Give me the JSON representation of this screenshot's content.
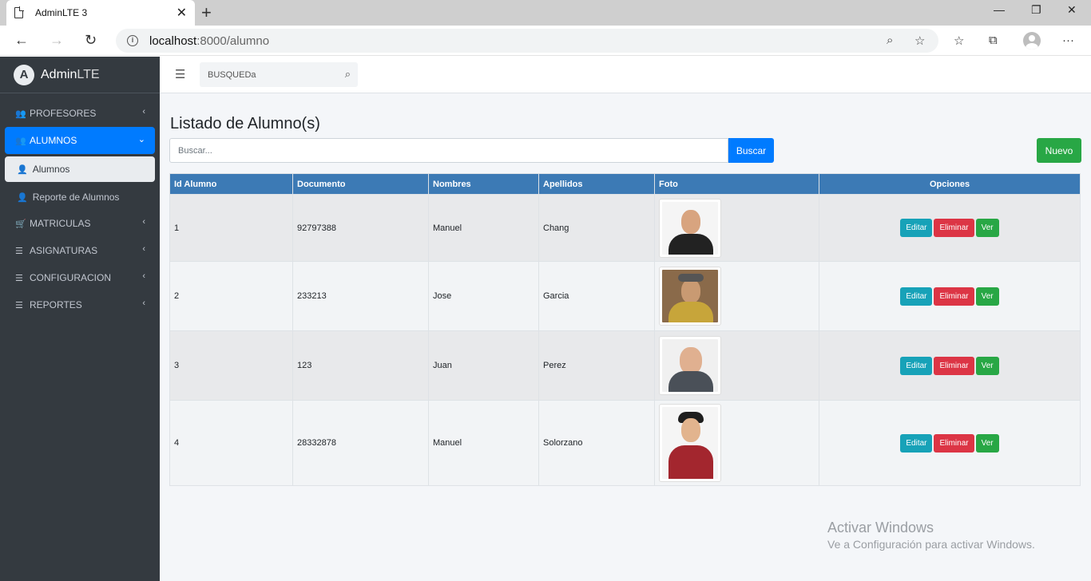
{
  "browser": {
    "tab_title": "AdminLTE 3",
    "url_host": "localhost",
    "url_path": ":8000/alumno"
  },
  "sidebar": {
    "brand_bold": "Admin",
    "brand_light": "LTE",
    "items": [
      {
        "label": "PROFESORES",
        "icon": "users-icon"
      },
      {
        "label": "ALUMNOS",
        "icon": "users-icon",
        "active": true
      },
      {
        "label": "MATRICULAS",
        "icon": "cart-icon"
      },
      {
        "label": "ASIGNATURAS",
        "icon": "list-icon"
      },
      {
        "label": "CONFIGURACION",
        "icon": "list-icon"
      },
      {
        "label": "REPORTES",
        "icon": "list-icon"
      }
    ],
    "subitems": [
      {
        "label": "Alumnos",
        "icon": "user-icon",
        "active": true
      },
      {
        "label": "Reporte de Alumnos",
        "icon": "user-icon"
      }
    ]
  },
  "topnav": {
    "search_placeholder": "BUSQUEDa"
  },
  "main": {
    "title": "Listado de Alumno(s)",
    "filter_placeholder": "Buscar...",
    "search_button": "Buscar",
    "new_button": "Nuevo",
    "columns": [
      "Id Alumno",
      "Documento",
      "Nombres",
      "Apellidos",
      "Foto",
      "Opciones"
    ],
    "rows": [
      {
        "id": "1",
        "documento": "92797388",
        "nombres": "Manuel",
        "apellidos": "Chang"
      },
      {
        "id": "2",
        "documento": "233213",
        "nombres": "Jose",
        "apellidos": "Garcia"
      },
      {
        "id": "3",
        "documento": "123",
        "nombres": "Juan",
        "apellidos": "Perez"
      },
      {
        "id": "4",
        "documento": "28332878",
        "nombres": "Manuel",
        "apellidos": "Solorzano"
      }
    ],
    "actions": {
      "edit": "Editar",
      "delete": "Eliminar",
      "view": "Ver"
    }
  },
  "watermark": {
    "line1": "Activar Windows",
    "line2": "Ve a Configuración para activar Windows."
  },
  "colors": {
    "sidebar_bg": "#343a40",
    "primary": "#007bff",
    "success": "#28a745",
    "info": "#17a2b8",
    "danger": "#dc3545",
    "table_header": "#3c7ab5"
  }
}
